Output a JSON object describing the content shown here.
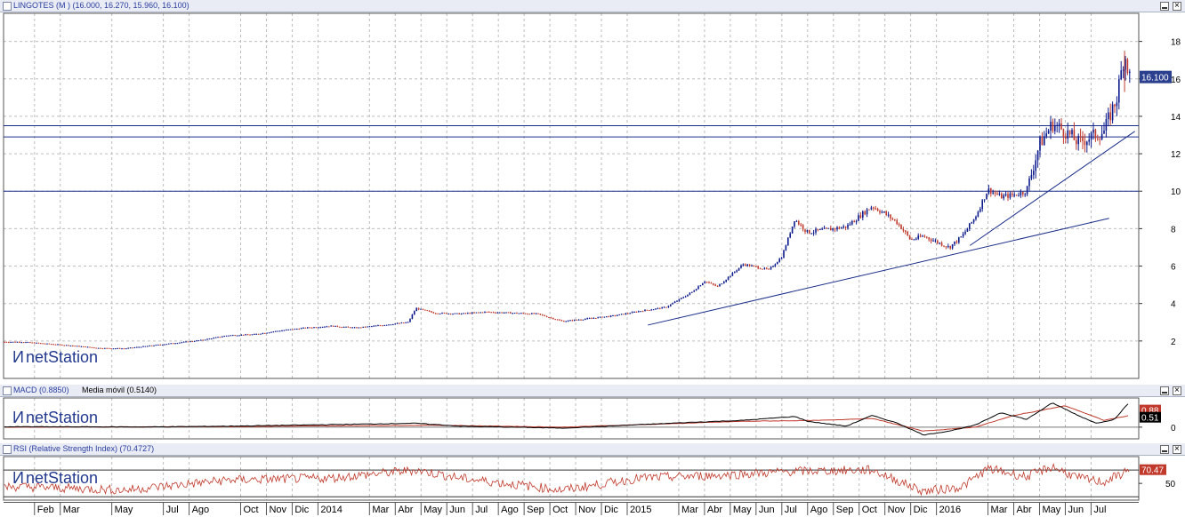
{
  "main_panel": {
    "title": "LINGOTES (M ) (16.000, 16.270, 15.960, 16.100)",
    "price_tag": "16.100",
    "logo": "netStation"
  },
  "macd_panel": {
    "title": "MACD (0.8850)",
    "title2": "Media móvil (0.5140)",
    "tag1": "0.88",
    "tag2": "0.51",
    "logo": "netStation"
  },
  "rsi_panel": {
    "title": "RSI (Relative Strength Index) (70.4727)",
    "tag": "70.47",
    "logo": "netStation"
  },
  "colors": {
    "accent": "#1a2e8a",
    "up": "#0b1a8c",
    "down": "#c0392b",
    "signal": "#000000",
    "rsi": "#c0392b",
    "header_bg": "#e9ecf4",
    "grid": "#bdbdbd"
  },
  "icons": {
    "checkbox": "checkbox-icon",
    "minimize": "minimize-icon",
    "close": "close-icon",
    "logo": "netstation-logo-icon"
  },
  "chart_data": [
    {
      "type": "line",
      "subtype": "candlestick",
      "title": "LINGOTES (M ) (16.000, 16.270, 15.960, 16.100)",
      "ylim": [
        0,
        19.5
      ],
      "y_ticks": [
        2,
        4,
        6,
        8,
        10,
        12,
        14,
        16,
        18
      ],
      "grid": true,
      "x_tick_labels": [
        "Feb",
        "Mar",
        "May",
        "Jul",
        "Ago",
        "Oct",
        "Nov",
        "Dic",
        "2014",
        "Mar",
        "Abr",
        "May",
        "Jun",
        "Jul",
        "Ago",
        "Sep",
        "Oct",
        "Nov",
        "Dic",
        "2015",
        "Mar",
        "Abr",
        "May",
        "Jun",
        "Jul",
        "Ago",
        "Sep",
        "Oct",
        "Nov",
        "Dic",
        "2016",
        "Mar",
        "Abr",
        "May",
        "Jun",
        "Jul"
      ],
      "x_months": [
        0.5,
        1.5,
        3.5,
        5.5,
        6.5,
        8.5,
        9.5,
        10.5,
        11.5,
        13.5,
        14.5,
        15.5,
        16.5,
        17.5,
        18.5,
        19.5,
        20.5,
        21.5,
        22.5,
        23.5,
        25.5,
        26.5,
        27.5,
        28.5,
        29.5,
        30.5,
        31.5,
        32.5,
        33.5,
        34.5,
        35.5,
        37.5,
        38.5,
        39.5,
        40.5,
        41.5
      ],
      "close": [
        [
          0,
          1.95
        ],
        [
          1,
          1.85
        ],
        [
          2,
          1.75
        ],
        [
          3,
          1.62
        ],
        [
          4,
          1.6
        ],
        [
          5,
          1.75
        ],
        [
          6,
          1.9
        ],
        [
          7,
          2.05
        ],
        [
          8,
          2.3
        ],
        [
          9,
          2.35
        ],
        [
          10,
          2.55
        ],
        [
          11,
          2.7
        ],
        [
          12,
          2.8
        ],
        [
          13,
          2.7
        ],
        [
          14,
          2.85
        ],
        [
          15,
          3.0
        ],
        [
          15.3,
          3.75
        ],
        [
          16,
          3.5
        ],
        [
          17,
          3.45
        ],
        [
          18,
          3.55
        ],
        [
          19,
          3.5
        ],
        [
          20,
          3.45
        ],
        [
          21,
          3.05
        ],
        [
          22,
          3.2
        ],
        [
          23,
          3.35
        ],
        [
          24,
          3.6
        ],
        [
          25,
          3.8
        ],
        [
          26,
          4.6
        ],
        [
          26.5,
          5.2
        ],
        [
          27,
          4.9
        ],
        [
          28,
          6.1
        ],
        [
          29,
          5.8
        ],
        [
          29.5,
          6.5
        ],
        [
          30,
          8.5
        ],
        [
          30.5,
          7.8
        ],
        [
          31,
          7.9
        ],
        [
          32,
          8.1
        ],
        [
          33,
          9.2
        ],
        [
          33.5,
          8.8
        ],
        [
          34,
          8.3
        ],
        [
          34.5,
          7.4
        ],
        [
          35,
          7.6
        ],
        [
          35.5,
          7.3
        ],
        [
          36,
          7.0
        ],
        [
          36.5,
          7.6
        ],
        [
          37,
          8.6
        ],
        [
          37.5,
          10.1
        ],
        [
          38,
          9.7
        ],
        [
          38.5,
          9.8
        ],
        [
          39,
          10.0
        ],
        [
          39.5,
          12.5
        ],
        [
          40,
          13.6
        ],
        [
          40.5,
          13.2
        ],
        [
          41,
          12.6
        ],
        [
          41.5,
          12.9
        ],
        [
          42,
          13.2
        ],
        [
          42.5,
          15.0
        ],
        [
          42.8,
          17.4
        ],
        [
          43,
          16.1
        ]
      ],
      "lines": {
        "horizontal": [
          13.5,
          12.9,
          10.0
        ],
        "trendlines": [
          {
            "from": [
              24.3,
              2.85
            ],
            "to": [
              42.2,
              8.55
            ]
          },
          {
            "from": [
              36.8,
              7.1
            ],
            "to": [
              43.2,
              13.2
            ]
          }
        ]
      },
      "last_value": 16.1
    },
    {
      "type": "line",
      "title": "MACD (0.8850)",
      "series": [
        {
          "name": "MACD (0.8850)",
          "values": [
            [
              0,
              0.02
            ],
            [
              5,
              0.01
            ],
            [
              8,
              0.05
            ],
            [
              15.3,
              0.2
            ],
            [
              17,
              0.05
            ],
            [
              21,
              -0.05
            ],
            [
              26,
              0.25
            ],
            [
              28,
              0.35
            ],
            [
              30,
              0.55
            ],
            [
              30.5,
              0.3
            ],
            [
              32,
              0.05
            ],
            [
              33,
              0.6
            ],
            [
              34,
              0.2
            ],
            [
              35,
              -0.4
            ],
            [
              36,
              -0.2
            ],
            [
              37,
              0.1
            ],
            [
              38,
              0.75
            ],
            [
              39,
              0.4
            ],
            [
              40,
              1.25
            ],
            [
              41,
              0.6
            ],
            [
              41.7,
              0.2
            ],
            [
              42.4,
              0.4
            ],
            [
              43,
              1.3
            ]
          ]
        },
        {
          "name": "Media móvil (0.5140)",
          "values": [
            [
              0,
              0.0
            ],
            [
              8,
              0.03
            ],
            [
              16,
              0.1
            ],
            [
              21,
              0.0
            ],
            [
              28,
              0.3
            ],
            [
              31,
              0.35
            ],
            [
              33,
              0.45
            ],
            [
              35,
              -0.2
            ],
            [
              37,
              0.0
            ],
            [
              38.5,
              0.6
            ],
            [
              40.5,
              1.1
            ],
            [
              42,
              0.35
            ],
            [
              43,
              0.6
            ]
          ]
        }
      ],
      "ylim": [
        -0.6,
        1.5
      ],
      "y_ticks": [
        0
      ],
      "last_values": [
        0.88,
        0.51
      ]
    },
    {
      "type": "line",
      "title": "RSI (Relative Strength Index) (70.4727)",
      "series": [
        {
          "name": "RSI (Relative Strength Index) (70.4727)",
          "values": [
            [
              0,
              45
            ],
            [
              4,
              40
            ],
            [
              8,
              55
            ],
            [
              12,
              58
            ],
            [
              15.3,
              70
            ],
            [
              17,
              58
            ],
            [
              21,
              40
            ],
            [
              24,
              58
            ],
            [
              27,
              62
            ],
            [
              30,
              68
            ],
            [
              33,
              70
            ],
            [
              35,
              38
            ],
            [
              36.5,
              45
            ],
            [
              37.5,
              72
            ],
            [
              39,
              60
            ],
            [
              40,
              75
            ],
            [
              41,
              58
            ],
            [
              42,
              52
            ],
            [
              43,
              70
            ]
          ]
        }
      ],
      "ylim": [
        25,
        90
      ],
      "y_ticks": [
        50
      ],
      "reference_lines": [
        70,
        30
      ],
      "last_value": 70.47
    }
  ]
}
